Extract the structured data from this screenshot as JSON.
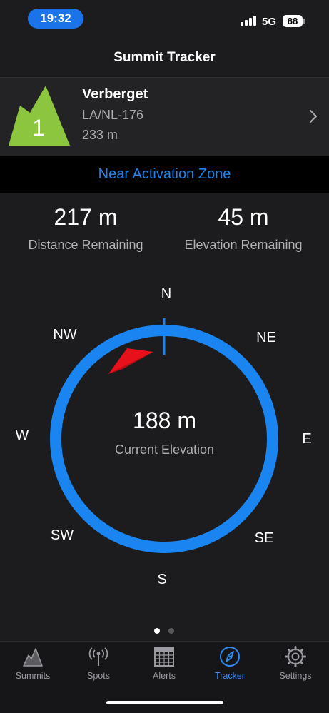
{
  "status_bar": {
    "time": "19:32",
    "network": "5G",
    "battery": "88"
  },
  "header": {
    "title": "Summit Tracker"
  },
  "summit": {
    "rank": "1",
    "name": "Verberget",
    "reference": "LA/NL-176",
    "altitude": "233 m",
    "icon": "mountain-icon",
    "color": "#8cc63f"
  },
  "zone_status": "Near Activation Zone",
  "stats": {
    "distance": {
      "value": "217 m",
      "label": "Distance Remaining"
    },
    "elevation": {
      "value": "45 m",
      "label": "Elevation Remaining"
    }
  },
  "compass": {
    "directions": {
      "n": "N",
      "ne": "NE",
      "e": "E",
      "se": "SE",
      "s": "S",
      "sw": "SW",
      "w": "W",
      "nw": "NW"
    },
    "current_elevation": {
      "value": "188 m",
      "label": "Current Elevation"
    },
    "ring_color": "#1a85f0",
    "pointer_color": "#e8101a"
  },
  "pager": {
    "pages": 2,
    "current": 1
  },
  "tabs": [
    {
      "label": "Summits",
      "icon": "mountain-outline-icon"
    },
    {
      "label": "Spots",
      "icon": "antenna-icon"
    },
    {
      "label": "Alerts",
      "icon": "calendar-icon"
    },
    {
      "label": "Tracker",
      "icon": "compass-icon",
      "active": true
    },
    {
      "label": "Settings",
      "icon": "gear-icon"
    }
  ]
}
